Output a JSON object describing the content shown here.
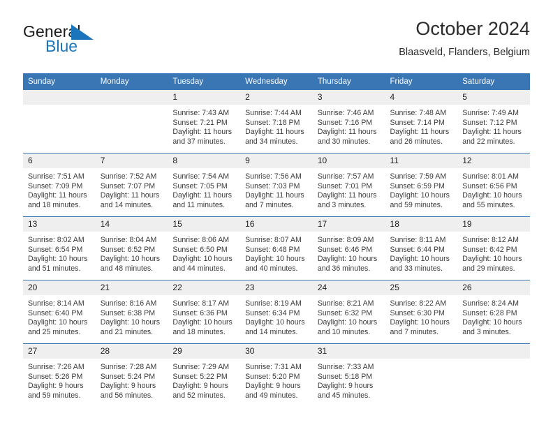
{
  "logo": {
    "word_one": "General",
    "word_two": "Blue",
    "triangle_color": "#1b75bb",
    "text_color": "#1b1b1b"
  },
  "header": {
    "month_title": "October 2024",
    "location": "Blaasveld, Flanders, Belgium"
  },
  "theme": {
    "header_blue": "#3a75b4",
    "daynum_band": "#efefef",
    "body_text": "#3b3b3b"
  },
  "weekday_headers": [
    "Sunday",
    "Monday",
    "Tuesday",
    "Wednesday",
    "Thursday",
    "Friday",
    "Saturday"
  ],
  "weeks": [
    [
      {
        "day": "",
        "sunrise": "",
        "sunset": "",
        "daylight": "",
        "empty": true
      },
      {
        "day": "",
        "sunrise": "",
        "sunset": "",
        "daylight": "",
        "empty": true
      },
      {
        "day": "1",
        "sunrise": "Sunrise: 7:43 AM",
        "sunset": "Sunset: 7:21 PM",
        "daylight": "Daylight: 11 hours and 37 minutes."
      },
      {
        "day": "2",
        "sunrise": "Sunrise: 7:44 AM",
        "sunset": "Sunset: 7:18 PM",
        "daylight": "Daylight: 11 hours and 34 minutes."
      },
      {
        "day": "3",
        "sunrise": "Sunrise: 7:46 AM",
        "sunset": "Sunset: 7:16 PM",
        "daylight": "Daylight: 11 hours and 30 minutes."
      },
      {
        "day": "4",
        "sunrise": "Sunrise: 7:48 AM",
        "sunset": "Sunset: 7:14 PM",
        "daylight": "Daylight: 11 hours and 26 minutes."
      },
      {
        "day": "5",
        "sunrise": "Sunrise: 7:49 AM",
        "sunset": "Sunset: 7:12 PM",
        "daylight": "Daylight: 11 hours and 22 minutes."
      }
    ],
    [
      {
        "day": "6",
        "sunrise": "Sunrise: 7:51 AM",
        "sunset": "Sunset: 7:09 PM",
        "daylight": "Daylight: 11 hours and 18 minutes."
      },
      {
        "day": "7",
        "sunrise": "Sunrise: 7:52 AM",
        "sunset": "Sunset: 7:07 PM",
        "daylight": "Daylight: 11 hours and 14 minutes."
      },
      {
        "day": "8",
        "sunrise": "Sunrise: 7:54 AM",
        "sunset": "Sunset: 7:05 PM",
        "daylight": "Daylight: 11 hours and 11 minutes."
      },
      {
        "day": "9",
        "sunrise": "Sunrise: 7:56 AM",
        "sunset": "Sunset: 7:03 PM",
        "daylight": "Daylight: 11 hours and 7 minutes."
      },
      {
        "day": "10",
        "sunrise": "Sunrise: 7:57 AM",
        "sunset": "Sunset: 7:01 PM",
        "daylight": "Daylight: 11 hours and 3 minutes."
      },
      {
        "day": "11",
        "sunrise": "Sunrise: 7:59 AM",
        "sunset": "Sunset: 6:59 PM",
        "daylight": "Daylight: 10 hours and 59 minutes."
      },
      {
        "day": "12",
        "sunrise": "Sunrise: 8:01 AM",
        "sunset": "Sunset: 6:56 PM",
        "daylight": "Daylight: 10 hours and 55 minutes."
      }
    ],
    [
      {
        "day": "13",
        "sunrise": "Sunrise: 8:02 AM",
        "sunset": "Sunset: 6:54 PM",
        "daylight": "Daylight: 10 hours and 51 minutes."
      },
      {
        "day": "14",
        "sunrise": "Sunrise: 8:04 AM",
        "sunset": "Sunset: 6:52 PM",
        "daylight": "Daylight: 10 hours and 48 minutes."
      },
      {
        "day": "15",
        "sunrise": "Sunrise: 8:06 AM",
        "sunset": "Sunset: 6:50 PM",
        "daylight": "Daylight: 10 hours and 44 minutes."
      },
      {
        "day": "16",
        "sunrise": "Sunrise: 8:07 AM",
        "sunset": "Sunset: 6:48 PM",
        "daylight": "Daylight: 10 hours and 40 minutes."
      },
      {
        "day": "17",
        "sunrise": "Sunrise: 8:09 AM",
        "sunset": "Sunset: 6:46 PM",
        "daylight": "Daylight: 10 hours and 36 minutes."
      },
      {
        "day": "18",
        "sunrise": "Sunrise: 8:11 AM",
        "sunset": "Sunset: 6:44 PM",
        "daylight": "Daylight: 10 hours and 33 minutes."
      },
      {
        "day": "19",
        "sunrise": "Sunrise: 8:12 AM",
        "sunset": "Sunset: 6:42 PM",
        "daylight": "Daylight: 10 hours and 29 minutes."
      }
    ],
    [
      {
        "day": "20",
        "sunrise": "Sunrise: 8:14 AM",
        "sunset": "Sunset: 6:40 PM",
        "daylight": "Daylight: 10 hours and 25 minutes."
      },
      {
        "day": "21",
        "sunrise": "Sunrise: 8:16 AM",
        "sunset": "Sunset: 6:38 PM",
        "daylight": "Daylight: 10 hours and 21 minutes."
      },
      {
        "day": "22",
        "sunrise": "Sunrise: 8:17 AM",
        "sunset": "Sunset: 6:36 PM",
        "daylight": "Daylight: 10 hours and 18 minutes."
      },
      {
        "day": "23",
        "sunrise": "Sunrise: 8:19 AM",
        "sunset": "Sunset: 6:34 PM",
        "daylight": "Daylight: 10 hours and 14 minutes."
      },
      {
        "day": "24",
        "sunrise": "Sunrise: 8:21 AM",
        "sunset": "Sunset: 6:32 PM",
        "daylight": "Daylight: 10 hours and 10 minutes."
      },
      {
        "day": "25",
        "sunrise": "Sunrise: 8:22 AM",
        "sunset": "Sunset: 6:30 PM",
        "daylight": "Daylight: 10 hours and 7 minutes."
      },
      {
        "day": "26",
        "sunrise": "Sunrise: 8:24 AM",
        "sunset": "Sunset: 6:28 PM",
        "daylight": "Daylight: 10 hours and 3 minutes."
      }
    ],
    [
      {
        "day": "27",
        "sunrise": "Sunrise: 7:26 AM",
        "sunset": "Sunset: 5:26 PM",
        "daylight": "Daylight: 9 hours and 59 minutes."
      },
      {
        "day": "28",
        "sunrise": "Sunrise: 7:28 AM",
        "sunset": "Sunset: 5:24 PM",
        "daylight": "Daylight: 9 hours and 56 minutes."
      },
      {
        "day": "29",
        "sunrise": "Sunrise: 7:29 AM",
        "sunset": "Sunset: 5:22 PM",
        "daylight": "Daylight: 9 hours and 52 minutes."
      },
      {
        "day": "30",
        "sunrise": "Sunrise: 7:31 AM",
        "sunset": "Sunset: 5:20 PM",
        "daylight": "Daylight: 9 hours and 49 minutes."
      },
      {
        "day": "31",
        "sunrise": "Sunrise: 7:33 AM",
        "sunset": "Sunset: 5:18 PM",
        "daylight": "Daylight: 9 hours and 45 minutes."
      },
      {
        "day": "",
        "sunrise": "",
        "sunset": "",
        "daylight": "",
        "empty": true
      },
      {
        "day": "",
        "sunrise": "",
        "sunset": "",
        "daylight": "",
        "empty": true
      }
    ]
  ]
}
